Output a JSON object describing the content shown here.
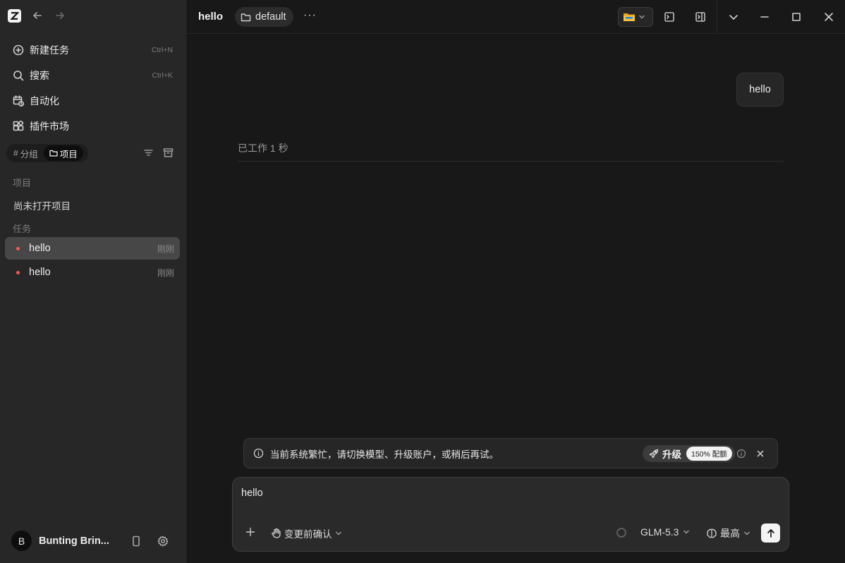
{
  "sidebar": {
    "logo_letter": "Z",
    "menu": [
      {
        "label": "新建任务",
        "shortcut": "Ctrl+N"
      },
      {
        "label": "搜索",
        "shortcut": "Ctrl+K"
      },
      {
        "label": "自动化",
        "shortcut": ""
      },
      {
        "label": "插件市场",
        "shortcut": ""
      }
    ],
    "segment": {
      "group_label": "分组",
      "project_label": "项目",
      "active": "项目"
    },
    "projects_header": "项目",
    "no_project": "尚未打开项目",
    "tasks_header": "任务",
    "tasks": [
      {
        "title": "hello",
        "time": "刚刚",
        "active": true
      },
      {
        "title": "hello",
        "time": "刚刚",
        "active": false
      }
    ],
    "user": {
      "initial": "B",
      "name": "Bunting Brin..."
    }
  },
  "topbar": {
    "title": "hello",
    "folder": "default",
    "more": "···"
  },
  "conversation": {
    "user_message": "hello",
    "worked_status": "已工作 1 秒"
  },
  "notice": {
    "text": "当前系统繁忙，请切换模型、升级账户，或稍后再试。",
    "upgrade_label": "升级",
    "quota_badge": "150% 配额"
  },
  "composer": {
    "input_value": "hello",
    "confirm_mode": "变更前确认",
    "model": "GLM-5.3",
    "effort": "最高"
  },
  "colors": {
    "task_dot": "#f05a5a",
    "sidebar_bg": "#272727",
    "main_bg": "#181818"
  }
}
